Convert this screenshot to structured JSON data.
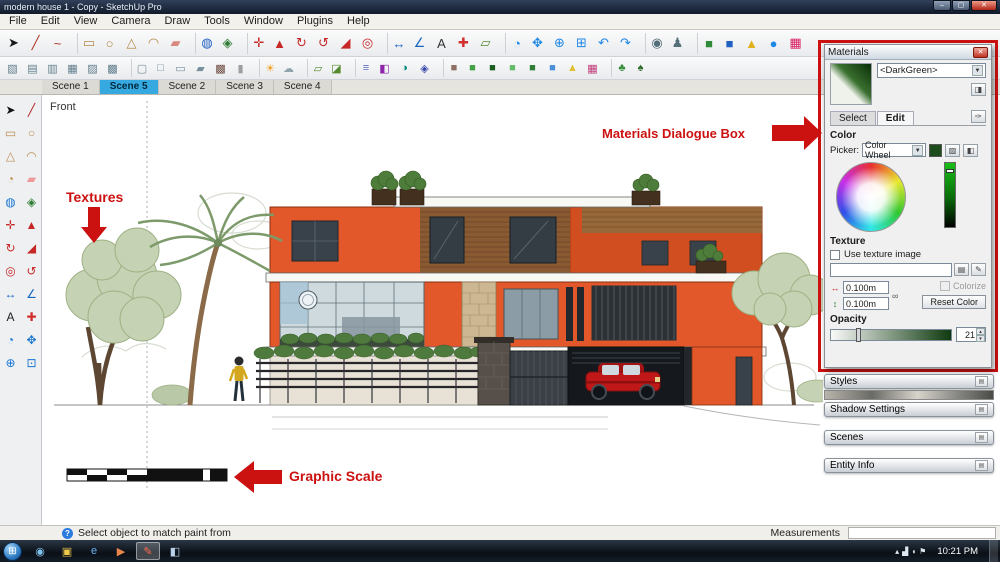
{
  "window": {
    "title": "modern house 1 - Copy - SketchUp Pro",
    "minimize_glyph": "–",
    "maximize_glyph": "▢",
    "close_glyph": "✕"
  },
  "menu_bar": {
    "items": [
      "File",
      "Edit",
      "View",
      "Camera",
      "Draw",
      "Tools",
      "Window",
      "Plugins",
      "Help"
    ]
  },
  "toolbar_row1": {
    "icons": [
      {
        "name": "select",
        "glyph": "➤",
        "color": "#1a1a1a"
      },
      {
        "name": "line",
        "glyph": "╱",
        "color": "#b03020"
      },
      {
        "name": "freehand",
        "glyph": "~",
        "color": "#b03020"
      },
      {
        "name": "rectangle",
        "glyph": "▭",
        "color": "#b5884c",
        "sep": true
      },
      {
        "name": "circle",
        "glyph": "○",
        "color": "#b5884c"
      },
      {
        "name": "polygon",
        "glyph": "△",
        "color": "#b5884c"
      },
      {
        "name": "arc",
        "glyph": "◠",
        "color": "#b5884c"
      },
      {
        "name": "eraser",
        "glyph": "▰",
        "color": "#d98880"
      },
      {
        "name": "paint-bucket",
        "glyph": "◍",
        "color": "#2060c0",
        "sep": true
      },
      {
        "name": "make-component",
        "glyph": "◈",
        "color": "#2e7d32"
      },
      {
        "name": "move",
        "glyph": "✛",
        "color": "#c62828",
        "sep": true
      },
      {
        "name": "push-pull",
        "glyph": "▲",
        "color": "#c62828"
      },
      {
        "name": "rotate",
        "glyph": "↻",
        "color": "#c62828"
      },
      {
        "name": "follow-me",
        "glyph": "↺",
        "color": "#c62828"
      },
      {
        "name": "scale",
        "glyph": "◢",
        "color": "#c62828"
      },
      {
        "name": "offset",
        "glyph": "◎",
        "color": "#c62828"
      },
      {
        "name": "tape-measure",
        "glyph": "↔",
        "color": "#1565c0",
        "sep": true
      },
      {
        "name": "protractor",
        "glyph": "∠",
        "color": "#1565c0"
      },
      {
        "name": "text",
        "glyph": "A",
        "color": "#333333"
      },
      {
        "name": "axes",
        "glyph": "✚",
        "color": "#d32f2f"
      },
      {
        "name": "section-plane",
        "glyph": "▱",
        "color": "#558b2f"
      },
      {
        "name": "orbit",
        "glyph": "◔",
        "color": "#1e88e5",
        "sep": true
      },
      {
        "name": "pan",
        "glyph": "✥",
        "color": "#1e88e5"
      },
      {
        "name": "zoom",
        "glyph": "⊕",
        "color": "#1e88e5"
      },
      {
        "name": "zoom-window",
        "glyph": "⊞",
        "color": "#1e88e5"
      },
      {
        "name": "previous-view",
        "glyph": "↶",
        "color": "#1e88e5"
      },
      {
        "name": "next-view",
        "glyph": "↷",
        "color": "#1e88e5"
      },
      {
        "name": "position-camera",
        "glyph": "◉",
        "color": "#546e7a",
        "sep": true
      },
      {
        "name": "walk",
        "glyph": "♟",
        "color": "#546e7a"
      },
      {
        "name": "component-cube-green",
        "glyph": "■",
        "color": "#2e8b3a",
        "sep": true
      },
      {
        "name": "component-cube-blue",
        "glyph": "■",
        "color": "#2060c0"
      },
      {
        "name": "cone-tool",
        "glyph": "▲",
        "color": "#e0b020"
      },
      {
        "name": "sphere-tool",
        "glyph": "●",
        "color": "#1e88e5"
      },
      {
        "name": "color-palette",
        "glyph": "▦",
        "color": "#d81b60"
      }
    ]
  },
  "toolbar_row2": {
    "icons": [
      {
        "name": "iso-view",
        "glyph": "▧",
        "color": "#607d8b"
      },
      {
        "name": "top-view",
        "glyph": "▤",
        "color": "#607d8b"
      },
      {
        "name": "front-view",
        "glyph": "▥",
        "color": "#607d8b"
      },
      {
        "name": "right-view",
        "glyph": "▦",
        "color": "#607d8b"
      },
      {
        "name": "back-view",
        "glyph": "▨",
        "color": "#607d8b"
      },
      {
        "name": "left-view",
        "glyph": "▩",
        "color": "#607d8b"
      },
      {
        "name": "xray-style",
        "glyph": "▢",
        "color": "#78909c",
        "sep": true
      },
      {
        "name": "wireframe-style",
        "glyph": "□",
        "color": "#78909c"
      },
      {
        "name": "hidden-line-style",
        "glyph": "▭",
        "color": "#78909c"
      },
      {
        "name": "shaded-style",
        "glyph": "▰",
        "color": "#78909c"
      },
      {
        "name": "textured-style",
        "glyph": "▩",
        "color": "#6d4c41"
      },
      {
        "name": "monochrome-style",
        "glyph": "▮",
        "color": "#9e9e9e"
      },
      {
        "name": "shadows-toggle",
        "glyph": "☀",
        "color": "#f0a020",
        "sep": true
      },
      {
        "name": "fog-toggle",
        "glyph": "☁",
        "color": "#90a4ae"
      },
      {
        "name": "section-display",
        "glyph": "▱",
        "color": "#558b2f",
        "sep": true
      },
      {
        "name": "section-cut",
        "glyph": "◪",
        "color": "#558b2f"
      },
      {
        "name": "layers-panel",
        "glyph": "≡",
        "color": "#5c6bc0",
        "sep": true
      },
      {
        "name": "materials-browser",
        "glyph": "◧",
        "color": "#8e24aa"
      },
      {
        "name": "styles-browser",
        "glyph": "◑",
        "color": "#00897b"
      },
      {
        "name": "components-browser",
        "glyph": "◈",
        "color": "#3949ab"
      },
      {
        "name": "group-cube",
        "glyph": "■",
        "color": "#8d6e63",
        "sep": true
      },
      {
        "name": "cube-light-green",
        "glyph": "■",
        "color": "#43a047"
      },
      {
        "name": "cube-dark-green",
        "glyph": "■",
        "color": "#1b5e20"
      },
      {
        "name": "cube-pale-green",
        "glyph": "■",
        "color": "#66bb6a"
      },
      {
        "name": "cube-forest",
        "glyph": "■",
        "color": "#2e7d32"
      },
      {
        "name": "cube-blue",
        "glyph": "■",
        "color": "#4a90d8"
      },
      {
        "name": "cone-yellow",
        "glyph": "▲",
        "color": "#e0c030"
      },
      {
        "name": "palette-grid",
        "glyph": "▦",
        "color": "#c03878"
      },
      {
        "name": "tree-component",
        "glyph": "♣",
        "color": "#388e3c",
        "sep": true
      },
      {
        "name": "shrub-component",
        "glyph": "♠",
        "color": "#2e6b2e"
      }
    ]
  },
  "left_toolbar": {
    "icons": [
      {
        "name": "select",
        "glyph": "➤",
        "color": "#111111"
      },
      {
        "name": "line",
        "glyph": "╱",
        "color": "#b71c1c"
      },
      {
        "name": "rectangle",
        "glyph": "▭",
        "color": "#bf8f55"
      },
      {
        "name": "circle",
        "glyph": "○",
        "color": "#bf8f55"
      },
      {
        "name": "polygon",
        "glyph": "△",
        "color": "#bf8f55"
      },
      {
        "name": "arc",
        "glyph": "◠",
        "color": "#bf8f55"
      },
      {
        "name": "pie",
        "glyph": "◔",
        "color": "#bf8f55"
      },
      {
        "name": "eraser",
        "glyph": "▰",
        "color": "#ef9a9a"
      },
      {
        "name": "paint-bucket",
        "glyph": "◍",
        "color": "#1976d2"
      },
      {
        "name": "make-component",
        "glyph": "◈",
        "color": "#2e7d32"
      },
      {
        "name": "move",
        "glyph": "✛",
        "color": "#c62828"
      },
      {
        "name": "push-pull",
        "glyph": "▲",
        "color": "#c62828"
      },
      {
        "name": "rotate",
        "glyph": "↻",
        "color": "#c62828"
      },
      {
        "name": "scale",
        "glyph": "◢",
        "color": "#c62828"
      },
      {
        "name": "offset",
        "glyph": "◎",
        "color": "#c62828"
      },
      {
        "name": "follow-me",
        "glyph": "↺",
        "color": "#c62828"
      },
      {
        "name": "tape-measure",
        "glyph": "↔",
        "color": "#1565c0"
      },
      {
        "name": "protractor",
        "glyph": "∠",
        "color": "#1565c0"
      },
      {
        "name": "text",
        "glyph": "A",
        "color": "#212121"
      },
      {
        "name": "axes",
        "glyph": "✚",
        "color": "#d32f2f"
      },
      {
        "name": "orbit",
        "glyph": "◔",
        "color": "#1976d2"
      },
      {
        "name": "pan",
        "glyph": "✥",
        "color": "#1976d2"
      },
      {
        "name": "zoom",
        "glyph": "⊕",
        "color": "#1976d2"
      },
      {
        "name": "zoom-extents",
        "glyph": "⊡",
        "color": "#1976d2"
      }
    ]
  },
  "scene_tabs": {
    "tabs": [
      {
        "label": "Scene 1",
        "active": false
      },
      {
        "label": "Scene 5",
        "active": true
      },
      {
        "label": "Scene 2",
        "active": false
      },
      {
        "label": "Scene 3",
        "active": false
      },
      {
        "label": "Scene 4",
        "active": false
      }
    ]
  },
  "canvas": {
    "view_label": "Front"
  },
  "annotations": {
    "textures_label": "Textures",
    "materials_label": "Materials Dialogue Box",
    "graphic_scale_label": "Graphic Scale",
    "accent_color": "#cc1111"
  },
  "materials_panel": {
    "title": "Materials",
    "material_name": "<DarkGreen>",
    "tab_select": "Select",
    "tab_edit": "Edit",
    "color_section": "Color",
    "picker_label": "Picker:",
    "picker_value": "Color Wheel",
    "texture_section": "Texture",
    "use_texture_image": "Use texture image",
    "tex_width": "0.100m",
    "tex_height": "0.100m",
    "colorize_label": "Colorize",
    "reset_color_label": "Reset Color",
    "opacity_section": "Opacity",
    "opacity_value": "21",
    "icons": {
      "dropdown_arrow": "▼",
      "secondary_pane": "◨",
      "eyedropper": "✑",
      "sample_swatch": "▨",
      "paint_swatch": "◧",
      "browse_texture": "▤",
      "edit_texture": "✎",
      "link": "∞",
      "width_arrow": "↔",
      "height_arrow": "↕",
      "spin_up": "▴",
      "spin_down": "▾",
      "close": "✕"
    }
  },
  "trays": {
    "rollup_glyph": "▤",
    "panels": [
      {
        "label": "Styles"
      },
      {
        "label": "Shadow Settings"
      },
      {
        "label": "Scenes"
      },
      {
        "label": "Entity Info"
      }
    ]
  },
  "status_bar": {
    "help_glyph": "?",
    "hint": "Select object to match paint from",
    "measurements_label": "Measurements"
  },
  "taskbar": {
    "start_glyph": "⊞",
    "time": "10:21 PM",
    "apps": [
      {
        "name": "media-app",
        "glyph": "◉",
        "color": "#7ec0e8"
      },
      {
        "name": "windows-explorer",
        "glyph": "▣",
        "color": "#f0c84a"
      },
      {
        "name": "internet-explorer",
        "glyph": "e",
        "color": "#6ab4f0"
      },
      {
        "name": "media-player",
        "glyph": "▶",
        "color": "#e8854a"
      },
      {
        "name": "sketchup",
        "glyph": "✎",
        "color": "#ff6a50",
        "active": true
      },
      {
        "name": "image-viewer",
        "glyph": "◧",
        "color": "#b8d0e8"
      }
    ],
    "tray_icons": [
      {
        "name": "hidden-icons",
        "glyph": "▴"
      },
      {
        "name": "network",
        "glyph": "▟"
      },
      {
        "name": "volume",
        "glyph": "◖"
      },
      {
        "name": "action-center",
        "glyph": "⚑"
      }
    ]
  }
}
